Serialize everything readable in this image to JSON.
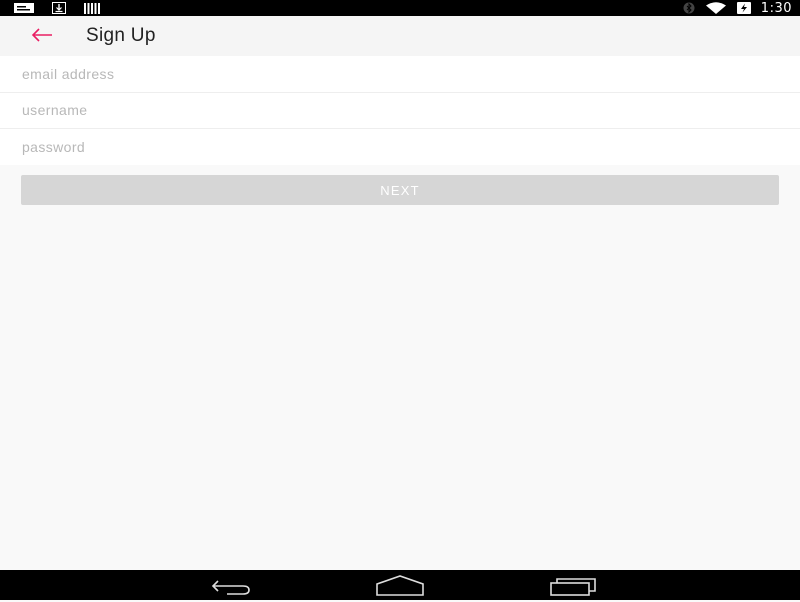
{
  "status_bar": {
    "time": "1:30",
    "icons": [
      "notification-card-icon",
      "download-icon",
      "barcode-icon",
      "bluetooth-icon",
      "wifi-icon",
      "battery-charging-icon"
    ]
  },
  "app_bar": {
    "back_icon": "arrow-back-icon",
    "title": "Sign Up",
    "accent_color": "#e91e63"
  },
  "form": {
    "email": {
      "placeholder": "email address",
      "value": ""
    },
    "username": {
      "placeholder": "username",
      "value": ""
    },
    "password": {
      "placeholder": "password",
      "value": ""
    }
  },
  "next_button": {
    "label": "NEXT",
    "color": "#d6d6d6"
  },
  "nav_bar": {
    "icons": [
      "nav-back-icon",
      "nav-home-icon",
      "nav-recents-icon"
    ]
  }
}
